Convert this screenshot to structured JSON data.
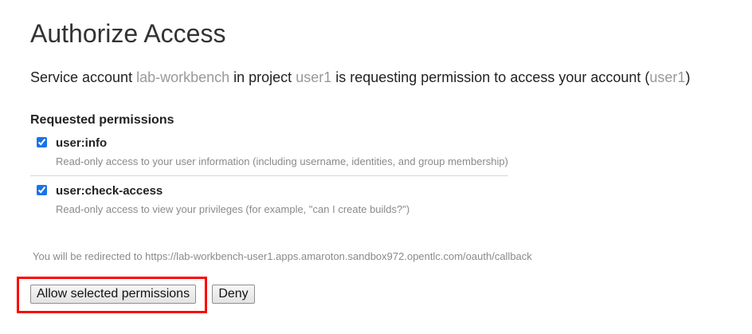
{
  "page": {
    "title": "Authorize Access"
  },
  "request": {
    "prefix": "Service account ",
    "service_account": "lab-workbench",
    "middle1": " in project ",
    "project": "user1",
    "middle2": " is requesting permission to access your account (",
    "account": "user1",
    "suffix": ")"
  },
  "permissions": {
    "heading": "Requested permissions",
    "items": [
      {
        "name": "user:info",
        "description": "Read-only access to your user information (including username, identities, and group membership)",
        "checked": true
      },
      {
        "name": "user:check-access",
        "description": "Read-only access to view your privileges (for example, \"can I create builds?\")",
        "checked": true
      }
    ]
  },
  "redirect": {
    "text": "You will be redirected to https://lab-workbench-user1.apps.amaroton.sandbox972.opentlc.com/oauth/callback"
  },
  "actions": {
    "allow_label": "Allow selected permissions",
    "deny_label": "Deny"
  },
  "colors": {
    "highlight": "#ff0000",
    "muted_text": "#999999",
    "checkbox_accent": "#1a73e8"
  }
}
